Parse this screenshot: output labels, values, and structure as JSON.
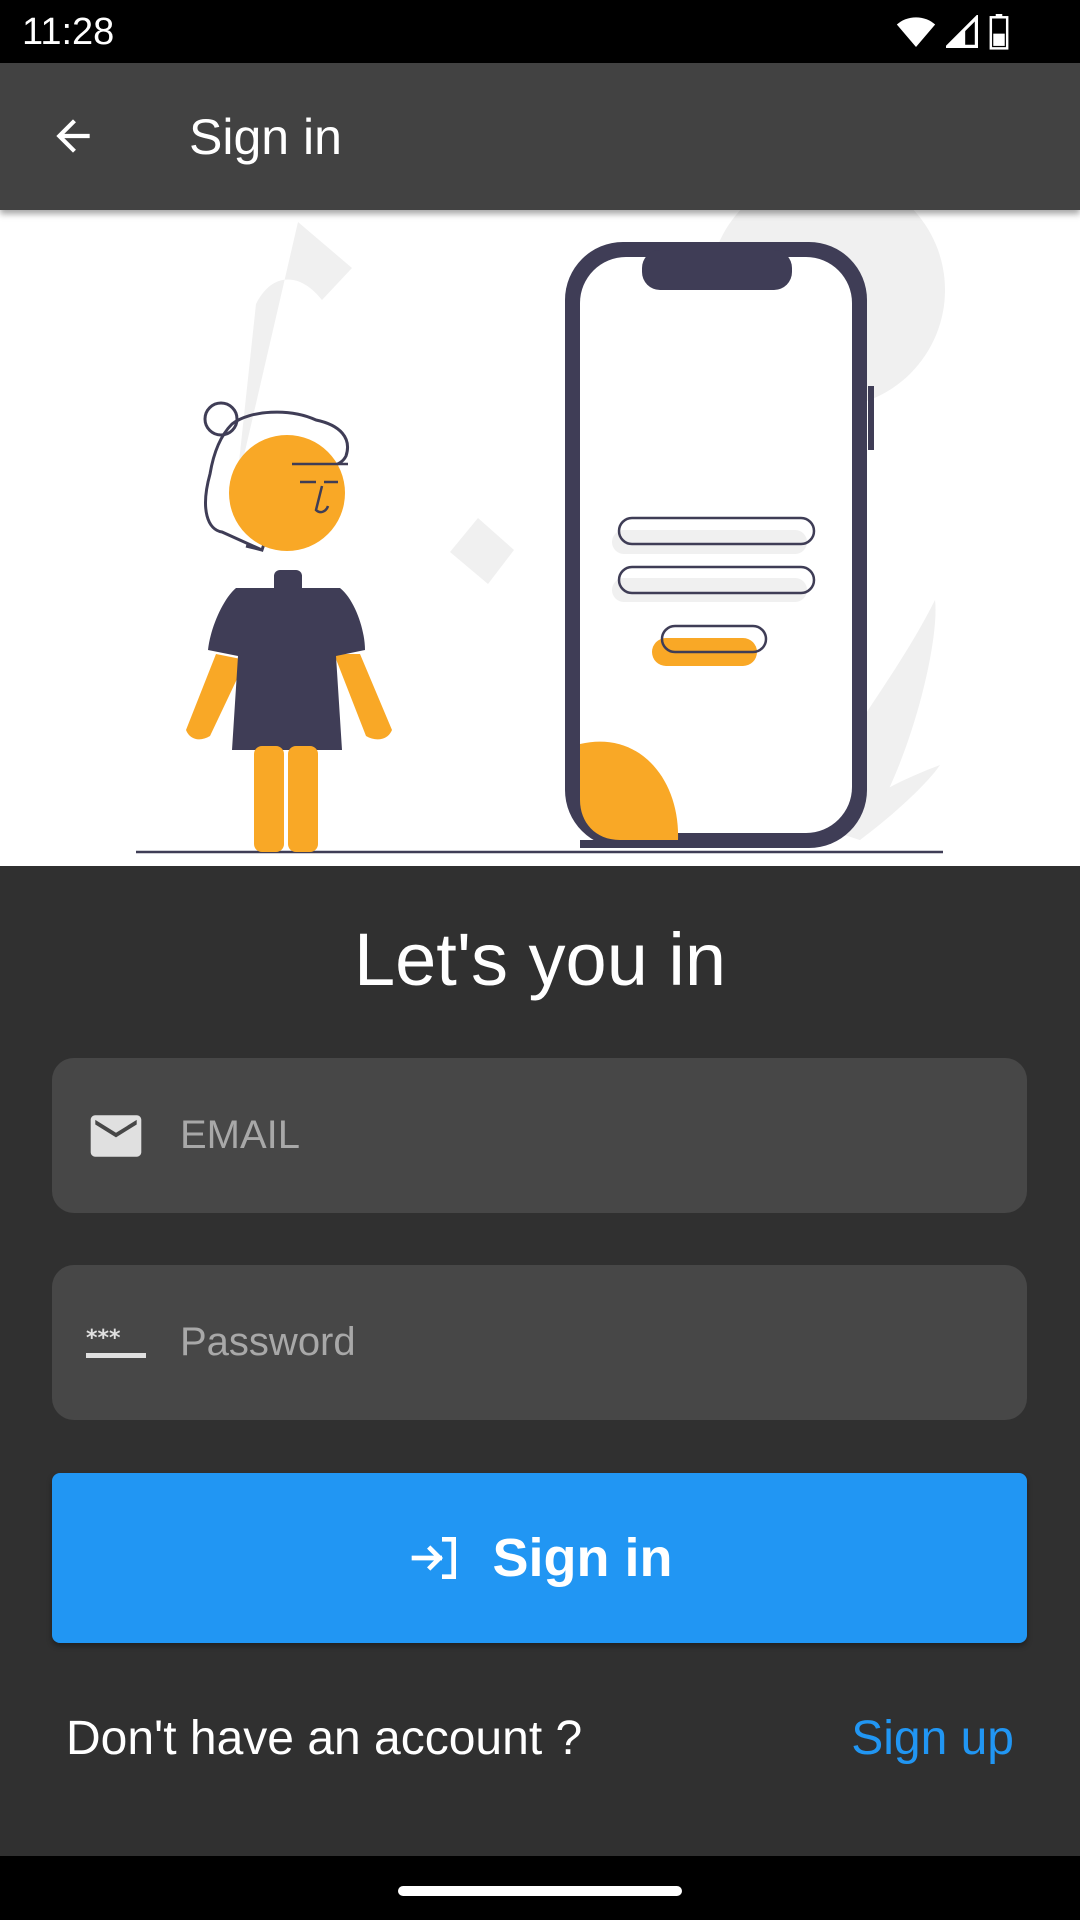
{
  "status_bar": {
    "time": "11:28"
  },
  "app_bar": {
    "title": "Sign in",
    "back_icon": "arrow-back-icon"
  },
  "illustration": {
    "description_icon": "person-with-phone-login-illustration",
    "colors": {
      "accent": "#f9a826",
      "dark": "#3f3d56",
      "light_gray": "#f0f0f0"
    }
  },
  "headline": "Let's you in",
  "form": {
    "email": {
      "placeholder": "EMAIL",
      "value": "",
      "icon": "mail-icon"
    },
    "password": {
      "placeholder": "Password",
      "value": "",
      "icon": "password-icon"
    },
    "submit": {
      "label": "Sign in",
      "icon": "login-icon"
    }
  },
  "footer": {
    "prompt": "Don't have an account ?",
    "link_label": "Sign up"
  },
  "colors": {
    "background": "#303030",
    "app_bar": "#424242",
    "field_bg": "#474747",
    "primary": "#2196f3"
  }
}
